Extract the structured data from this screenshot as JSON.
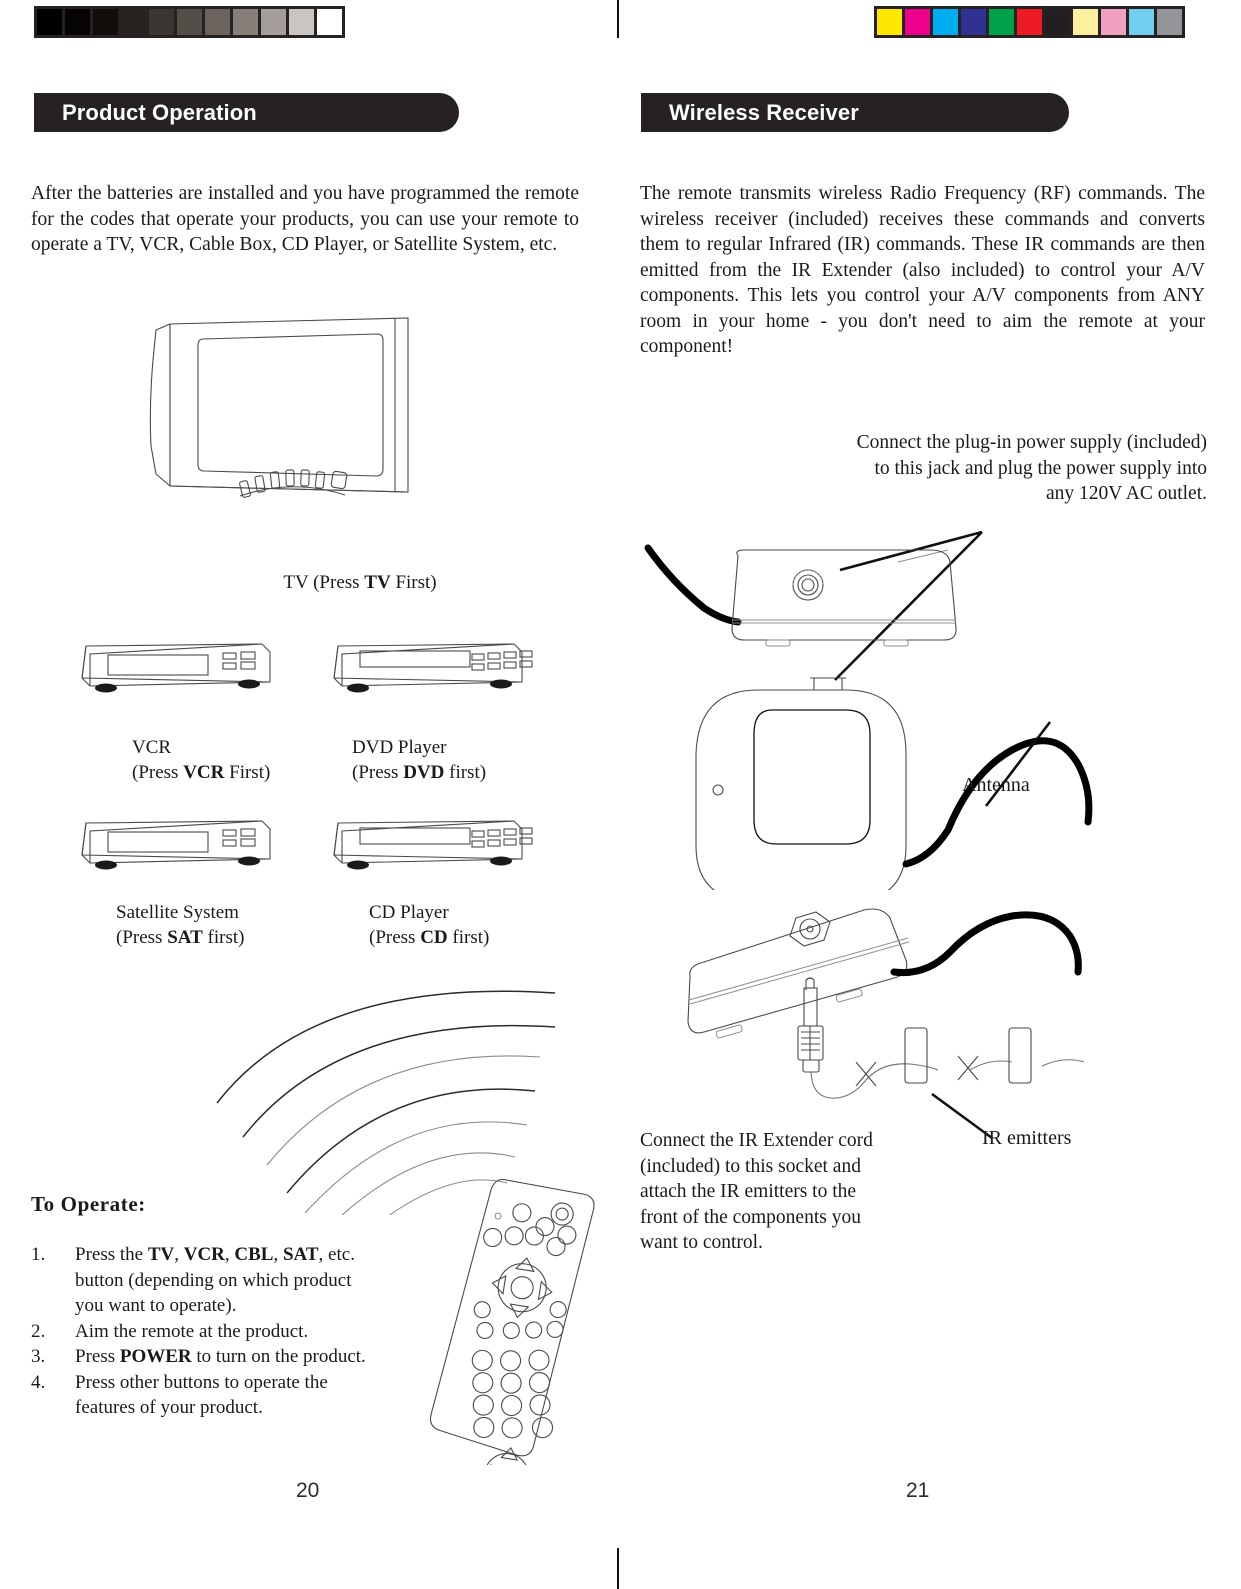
{
  "document": {
    "type": "scanned-manual-spread",
    "page_numbers": {
      "left": "20",
      "right": "21"
    }
  },
  "calibration": {
    "grayscale_bar": {
      "name": "grayscale-step-wedge",
      "patches": [
        "#000000",
        "#050303",
        "#120e0c",
        "#262220",
        "#3c3633",
        "#534c47",
        "#6b635d",
        "#877f7a",
        "#a49d98",
        "#cac5c1",
        "#ffffff"
      ]
    },
    "color_bar": {
      "name": "process-color-patches",
      "patches": [
        "#ffe800",
        "#ec008c",
        "#00aeef",
        "#2e3192",
        "#00a14b",
        "#ed1c24",
        "#231f20",
        "#fbf0a0",
        "#f2a0c0",
        "#6fcff0",
        "#939598"
      ]
    }
  },
  "left_page": {
    "header": {
      "title": "Product Operation"
    },
    "intro": "After the batteries are installed and you have programmed the remote for the codes that operate your products, you can use your remote to operate a TV, VCR, Cable Box, CD Player, or Satellite System, etc.",
    "figures": {
      "tv": {
        "name": "tv-illustration",
        "caption_plain_1": "TV (Press ",
        "caption_bold": "TV",
        "caption_plain_2": " First)"
      },
      "vcr": {
        "name": "vcr-illustration",
        "line1": "VCR",
        "line2_pre": "(Press ",
        "line2_bold": "VCR",
        "line2_post": " First)"
      },
      "dvd": {
        "name": "dvd-player-illustration",
        "line1": "DVD Player",
        "line2_pre": "(Press ",
        "line2_bold": "DVD",
        "line2_post": " first)"
      },
      "sat": {
        "name": "satellite-system-illustration",
        "line1": "Satellite System",
        "line2_pre": "(Press ",
        "line2_bold": "SAT",
        "line2_post": " first)"
      },
      "cd": {
        "name": "cd-player-illustration",
        "line1": "CD Player",
        "line2_pre": "(Press ",
        "line2_bold": "CD",
        "line2_post": " first)"
      },
      "remote": {
        "name": "remote-control-illustration"
      },
      "signal": {
        "name": "ir-signal-waves",
        "arc_count": 7
      }
    },
    "to_operate": {
      "title": "To  Operate:",
      "steps": [
        {
          "number": "1.",
          "pre": "Press the ",
          "b1": "TV",
          "s1": ", ",
          "b2": "VCR",
          "s2": ", ",
          "b3": "CBL",
          "s3": ", ",
          "b4": "SAT",
          "post": ", etc. button (depending on which product you want to operate)."
        },
        {
          "number": "2.",
          "pre": "Aim the remote at the product.",
          "b1": "",
          "s1": "",
          "b2": "",
          "s2": "",
          "b3": "",
          "s3": "",
          "b4": "",
          "post": ""
        },
        {
          "number": "3.",
          "pre": "Press ",
          "b1": "POWER",
          "s1": "",
          "b2": "",
          "s2": "",
          "b3": "",
          "s3": "",
          "b4": "",
          "post": " to turn on the product."
        },
        {
          "number": "4.",
          "pre": "Press other buttons to operate the features of your product.",
          "b1": "",
          "s1": "",
          "b2": "",
          "s2": "",
          "b3": "",
          "s3": "",
          "b4": "",
          "post": ""
        }
      ]
    }
  },
  "right_page": {
    "header": {
      "title": "Wireless Receiver"
    },
    "intro": "The remote transmits wireless Radio Frequency (RF) commands. The wireless receiver (included) receives these commands and converts them to regular Infrared (IR) commands. These IR commands are then emitted from the IR Extender (also included) to control your A/V components. This lets you control your A/V components from ANY room in your home - you don't need to aim the remote at your component!",
    "callouts": {
      "power_supply": "Connect the plug-in power supply (included) to this jack and plug the power supply into any 120V AC outlet.",
      "antenna": "Antenna",
      "ir_emitters": "IR emitters",
      "ir_extender": "Connect the IR Extender cord (included) to this socket and attach the IR emitters to the front of the components you want to control."
    },
    "figures": {
      "receiver": {
        "name": "wireless-receiver-illustration"
      },
      "extender": {
        "name": "ir-extender-illustration"
      }
    }
  }
}
